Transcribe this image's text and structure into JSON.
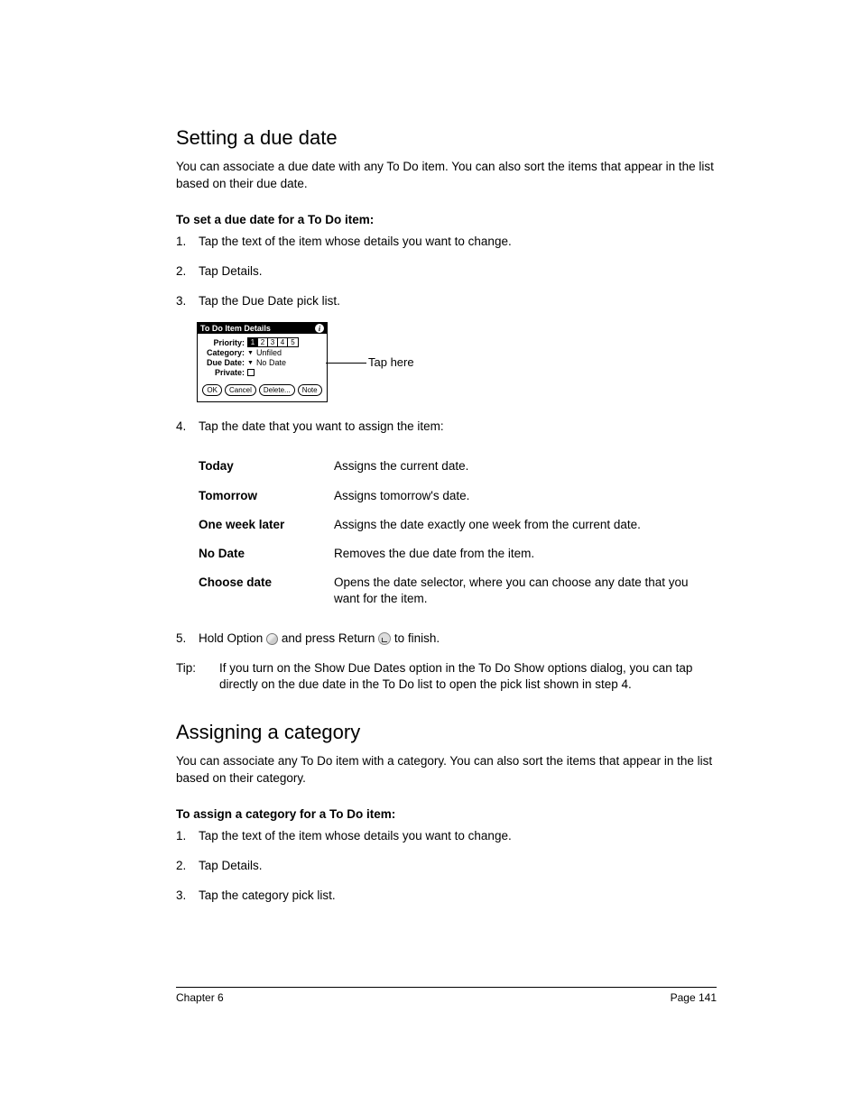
{
  "section1": {
    "heading": "Setting a due date",
    "intro": "You can associate a due date with any To Do item. You can also sort the items that appear in the list based on their due date.",
    "subhead": "To set a due date for a To Do item:",
    "steps": {
      "n1": "1.",
      "s1": "Tap the text of the item whose details you want to change.",
      "n2": "2.",
      "s2": "Tap Details.",
      "n3": "3.",
      "s3": "Tap the Due Date pick list.",
      "n4": "4.",
      "s4": "Tap the date that you want to assign the item:",
      "n5": "5.",
      "s5a": "Hold Option ",
      "s5b": " and press Return ",
      "s5c": " to finish."
    },
    "device": {
      "title": "To Do Item Details",
      "priority_label": "Priority:",
      "priority_values": [
        "1",
        "2",
        "3",
        "4",
        "5"
      ],
      "category_label": "Category:",
      "category_value": "Unfiled",
      "duedate_label": "Due Date:",
      "duedate_value": "No Date",
      "private_label": "Private:",
      "buttons": {
        "ok": "OK",
        "cancel": "Cancel",
        "delete": "Delete...",
        "note": "Note"
      }
    },
    "callout": "Tap here",
    "options": [
      {
        "term": "Today",
        "desc": "Assigns the current date."
      },
      {
        "term": "Tomorrow",
        "desc": "Assigns tomorrow's date."
      },
      {
        "term": "One week later",
        "desc": "Assigns the date exactly one week from the current date."
      },
      {
        "term": "No Date",
        "desc": "Removes the due date from the item."
      },
      {
        "term": "Choose date",
        "desc": "Opens the date selector, where you can choose any date that you want for the item."
      }
    ],
    "tip_label": "Tip:",
    "tip_text": "If you turn on the Show Due Dates option in the To Do Show options dialog, you can tap directly on the due date in the To Do list to open the pick list shown in step 4."
  },
  "section2": {
    "heading": "Assigning a category",
    "intro": "You can associate any To Do item with a category. You can also sort the items that appear in the list based on their category.",
    "subhead": "To assign a category for a To Do item:",
    "steps": {
      "n1": "1.",
      "s1": "Tap the text of the item whose details you want to change.",
      "n2": "2.",
      "s2": "Tap Details.",
      "n3": "3.",
      "s3": "Tap the category pick list."
    }
  },
  "footer": {
    "left": "Chapter 6",
    "right": "Page 141"
  }
}
